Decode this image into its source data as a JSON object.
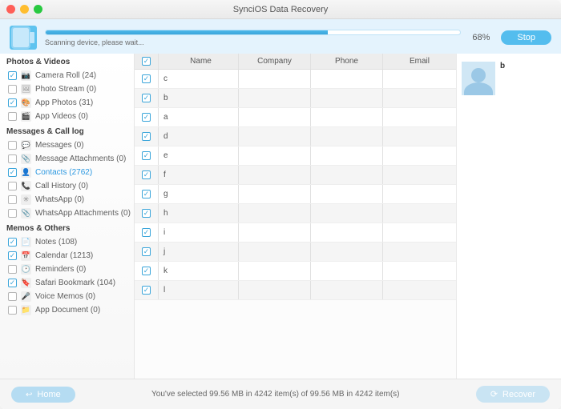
{
  "titlebar": {
    "title": "SynciOS Data Recovery"
  },
  "scan": {
    "status": "Scanning device, please wait...",
    "percent_label": "68%",
    "percent_value": 68,
    "stop_label": "Stop"
  },
  "sidebar": {
    "sections": [
      {
        "title": "Photos & Videos",
        "items": [
          {
            "label": "Camera Roll (24)",
            "checked": true,
            "icon": "📷"
          },
          {
            "label": "Photo Stream (0)",
            "checked": false,
            "icon": "🖼"
          },
          {
            "label": "App Photos (31)",
            "checked": true,
            "icon": "🎨"
          },
          {
            "label": "App Videos (0)",
            "checked": false,
            "icon": "🎬"
          }
        ]
      },
      {
        "title": "Messages & Call log",
        "items": [
          {
            "label": "Messages (0)",
            "checked": false,
            "icon": "💬"
          },
          {
            "label": "Message Attachments (0)",
            "checked": false,
            "icon": "📎"
          },
          {
            "label": "Contacts (2762)",
            "checked": true,
            "icon": "👤",
            "active": true
          },
          {
            "label": "Call History (0)",
            "checked": false,
            "icon": "📞"
          },
          {
            "label": "WhatsApp (0)",
            "checked": false,
            "icon": "✳"
          },
          {
            "label": "WhatsApp Attachments (0)",
            "checked": false,
            "icon": "📎"
          }
        ]
      },
      {
        "title": "Memos & Others",
        "items": [
          {
            "label": "Notes (108)",
            "checked": true,
            "icon": "📄"
          },
          {
            "label": "Calendar (1213)",
            "checked": true,
            "icon": "📅"
          },
          {
            "label": "Reminders (0)",
            "checked": false,
            "icon": "🕑"
          },
          {
            "label": "Safari Bookmark (104)",
            "checked": true,
            "icon": "🔖"
          },
          {
            "label": "Voice Memos (0)",
            "checked": false,
            "icon": "🎤"
          },
          {
            "label": "App Document (0)",
            "checked": false,
            "icon": "📁"
          }
        ]
      }
    ]
  },
  "table": {
    "headers": {
      "name": "Name",
      "company": "Company",
      "phone": "Phone",
      "email": "Email"
    },
    "rows": [
      {
        "checked": true,
        "name": "c",
        "company": "",
        "phone": "",
        "email": ""
      },
      {
        "checked": true,
        "name": "b",
        "company": "",
        "phone": "",
        "email": ""
      },
      {
        "checked": true,
        "name": "a",
        "company": "",
        "phone": "",
        "email": ""
      },
      {
        "checked": true,
        "name": "d",
        "company": "",
        "phone": "",
        "email": ""
      },
      {
        "checked": true,
        "name": "e",
        "company": "",
        "phone": "",
        "email": ""
      },
      {
        "checked": true,
        "name": "f",
        "company": "",
        "phone": "",
        "email": ""
      },
      {
        "checked": true,
        "name": "g",
        "company": "",
        "phone": "",
        "email": ""
      },
      {
        "checked": true,
        "name": "h",
        "company": "",
        "phone": "",
        "email": ""
      },
      {
        "checked": true,
        "name": "i",
        "company": "",
        "phone": "",
        "email": ""
      },
      {
        "checked": true,
        "name": "j",
        "company": "",
        "phone": "",
        "email": ""
      },
      {
        "checked": true,
        "name": "k",
        "company": "",
        "phone": "",
        "email": ""
      },
      {
        "checked": true,
        "name": "l",
        "company": "",
        "phone": "",
        "email": ""
      }
    ]
  },
  "detail": {
    "name": "b"
  },
  "footer": {
    "home_label": "Home",
    "status": "You've selected 99.56 MB in 4242 item(s) of 99.56 MB in 4242 item(s)",
    "recover_label": "Recover"
  }
}
